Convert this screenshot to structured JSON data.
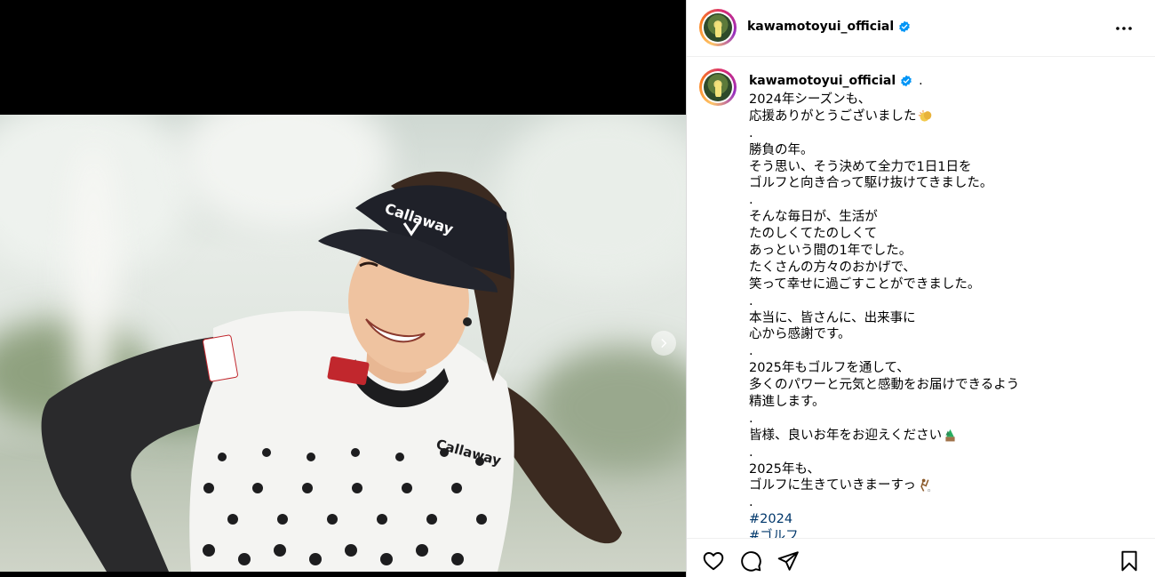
{
  "post": {
    "username": "kawamotoyui_official",
    "caption_dot": ".",
    "caption_lines": [
      {
        "text": "2024年シーズンも、",
        "type": "text"
      },
      {
        "text": "応援ありがとうございました",
        "type": "text",
        "emoji": "clapping-hands-emoji"
      },
      {
        "text": ".",
        "type": "text"
      },
      {
        "text": "勝負の年。",
        "type": "text"
      },
      {
        "text": "そう思い、そう決めて全力で1日1日を",
        "type": "text"
      },
      {
        "text": "ゴルフと向き合って駆け抜けてきました。",
        "type": "text"
      },
      {
        "text": ".",
        "type": "text"
      },
      {
        "text": "そんな毎日が、生活が",
        "type": "text"
      },
      {
        "text": "たのしくてたのしくて",
        "type": "text"
      },
      {
        "text": "あっという間の1年でした。",
        "type": "text"
      },
      {
        "text": "たくさんの方々のおかげで、",
        "type": "text"
      },
      {
        "text": "笑って幸せに過ごすことができました。",
        "type": "text"
      },
      {
        "text": ".",
        "type": "text"
      },
      {
        "text": "本当に、皆さんに、出来事に",
        "type": "text"
      },
      {
        "text": "心から感謝です。",
        "type": "text"
      },
      {
        "text": ".",
        "type": "text"
      },
      {
        "text": "2025年もゴルフを通して、",
        "type": "text"
      },
      {
        "text": "多くのパワーと元気と感動をお届けできるよう",
        "type": "text"
      },
      {
        "text": "精進します。",
        "type": "text"
      },
      {
        "text": ".",
        "type": "text"
      },
      {
        "text": "皆様、良いお年をお迎えください",
        "type": "text",
        "emoji": "pine-decoration-emoji"
      },
      {
        "text": ".",
        "type": "text"
      },
      {
        "text": "2025年も、",
        "type": "text"
      },
      {
        "text": "ゴルフに生きていきまーすっ",
        "type": "text",
        "emoji": "golfer-emoji"
      },
      {
        "text": ".",
        "type": "text"
      },
      {
        "text": "#2024",
        "type": "tag"
      },
      {
        "text": "#ゴルフ",
        "type": "tag"
      }
    ]
  },
  "icons": {
    "verified": "verified-badge-icon",
    "more": "more-options-icon",
    "next": "chevron-right-icon",
    "like": "heart-icon",
    "comment": "comment-icon",
    "share": "send-icon",
    "save": "bookmark-icon"
  },
  "colors": {
    "verified_blue": "#0095f6",
    "hashtag": "#00376b",
    "avatar_ring": [
      "#fdc468",
      "#fa7e1e",
      "#d62976",
      "#962fbf"
    ]
  }
}
